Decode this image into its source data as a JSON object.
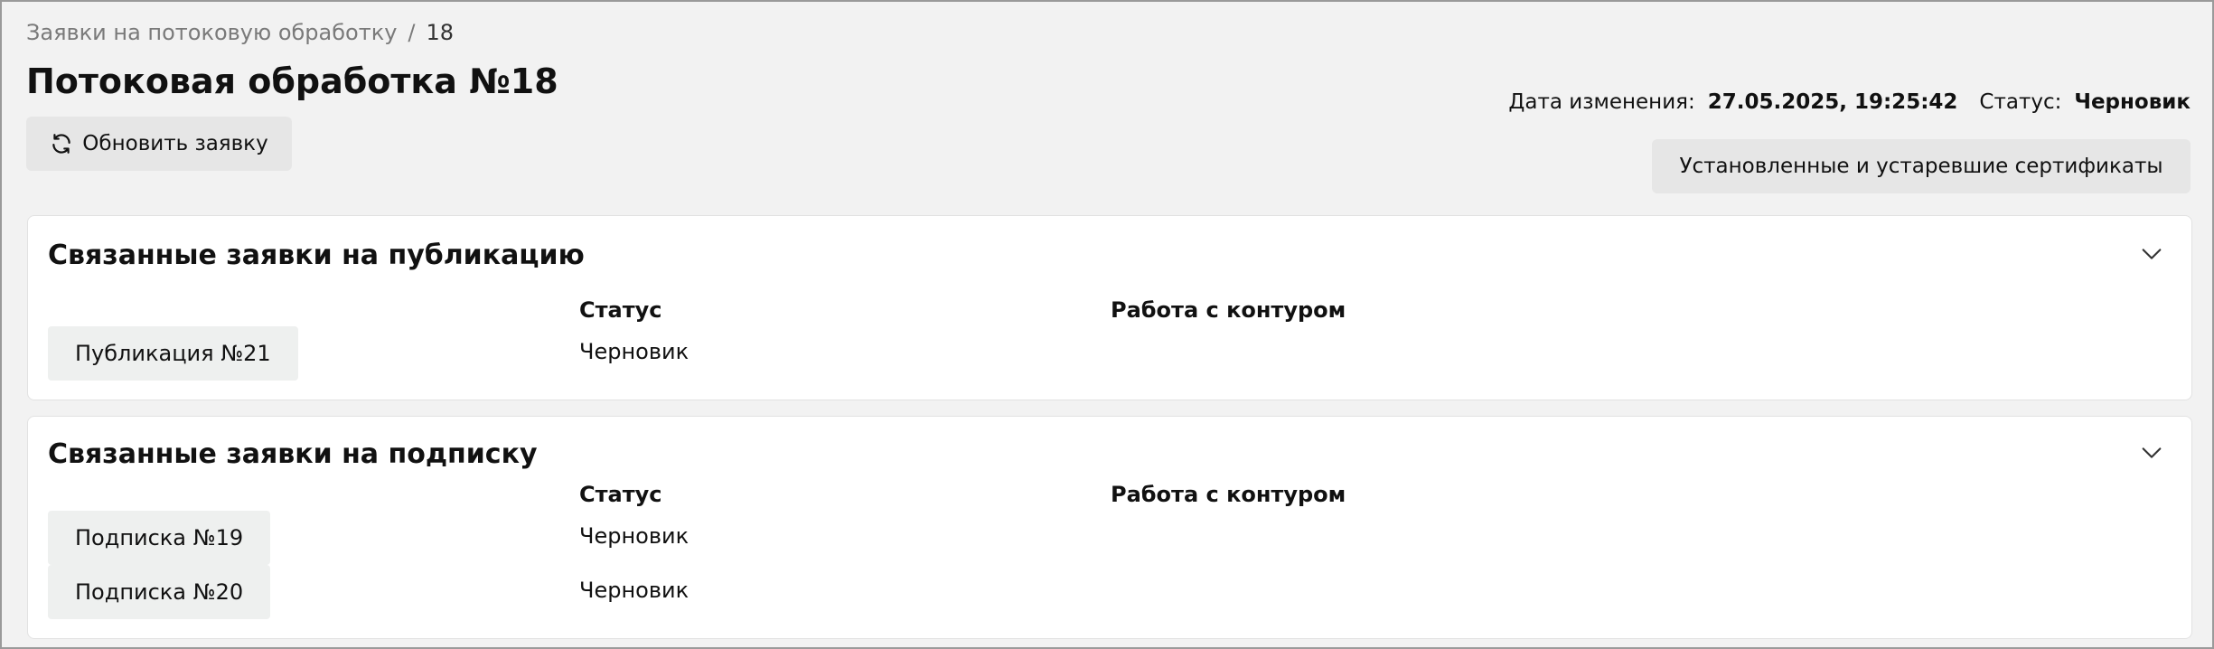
{
  "breadcrumb": {
    "parent": "Заявки на потоковую обработку",
    "separator": "/",
    "current": "18"
  },
  "page": {
    "title": "Потоковая обработка №18",
    "refresh_label": "Обновить заявку",
    "modified_label": "Дата изменения:",
    "modified_value": "27.05.2025, 19:25:42",
    "status_label": "Статус:",
    "status_value": "Черновик",
    "certs_label": "Установленные и устаревшие сертификаты"
  },
  "publication_section": {
    "title": "Связанные заявки на публикацию",
    "col_status": "Статус",
    "col_contour": "Работа с контуром",
    "rows": [
      {
        "name": "Публикация №21",
        "status": "Черновик",
        "contour": ""
      }
    ]
  },
  "subscription_section": {
    "title": "Связанные заявки на подписку",
    "col_status": "Статус",
    "col_contour": "Работа с контуром",
    "rows": [
      {
        "name": "Подписка №19",
        "status": "Черновик",
        "contour": ""
      },
      {
        "name": "Подписка №20",
        "status": "Черновик",
        "contour": ""
      }
    ]
  },
  "colors": {
    "background": "#f2f2f2",
    "card": "#ffffff",
    "button": "#e6e6e6"
  },
  "icons": [
    "refresh-icon",
    "chevron-down-icon"
  ]
}
